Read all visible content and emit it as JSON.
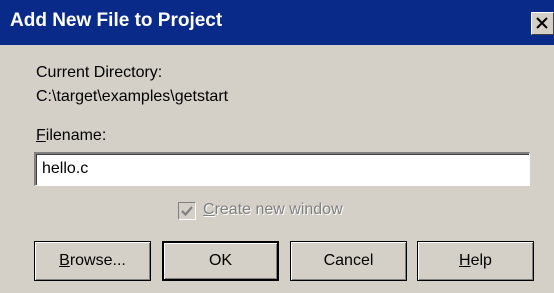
{
  "dialog": {
    "title": "Add New File to Project",
    "close_glyph": "×"
  },
  "current_dir": {
    "label": "Current Directory:",
    "path": "C:\\target\\examples\\getstart"
  },
  "filename": {
    "label_first": "F",
    "label_rest": "ilename:",
    "value": "hello.c"
  },
  "option": {
    "checked": true,
    "label_first": "C",
    "label_rest": "reate new window"
  },
  "buttons": {
    "browse": {
      "first": "B",
      "rest": "rowse..."
    },
    "ok": {
      "label": "OK"
    },
    "cancel": {
      "label": "Cancel"
    },
    "help": {
      "first": "H",
      "rest": "elp"
    }
  },
  "colors": {
    "titlebar": "#0a2a8a",
    "face": "#d4d0c8"
  }
}
